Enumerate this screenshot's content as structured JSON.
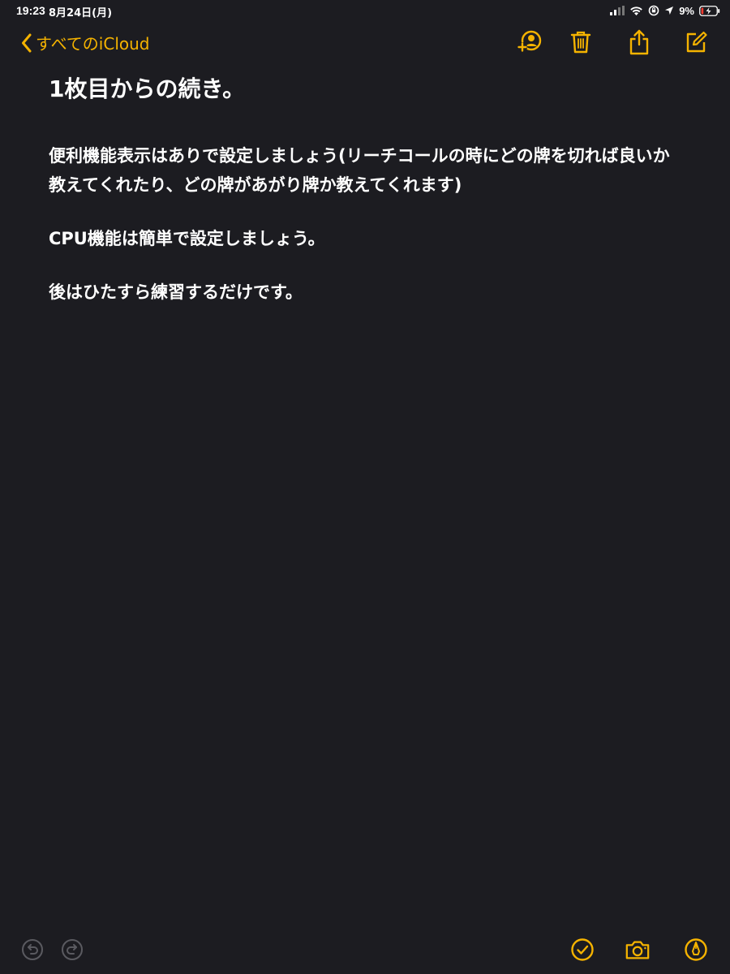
{
  "status_bar": {
    "time": "19:23",
    "date": "8月24日(月)",
    "battery_percent": "9%"
  },
  "nav": {
    "back_label": "すべてのiCloud"
  },
  "note": {
    "title": "1枚目からの続き。",
    "paragraphs": [
      "便利機能表示はありで設定しましょう(リーチコールの時にどの牌を切れば良いか教えてくれたり、どの牌があがり牌か教えてくれます)",
      "CPU機能は簡単で設定しましょう。",
      "後はひたすら練習するだけです。"
    ]
  },
  "colors": {
    "background": "#1c1c21",
    "accent": "#f5b300",
    "text": "#ffffff",
    "battery_low": "#ff3b30"
  },
  "icons": {
    "toolbar": [
      "add-person-icon",
      "trash-icon",
      "share-icon",
      "compose-icon"
    ],
    "bottom": [
      "undo-icon",
      "redo-icon",
      "checklist-icon",
      "camera-icon",
      "markup-pen-icon"
    ]
  }
}
